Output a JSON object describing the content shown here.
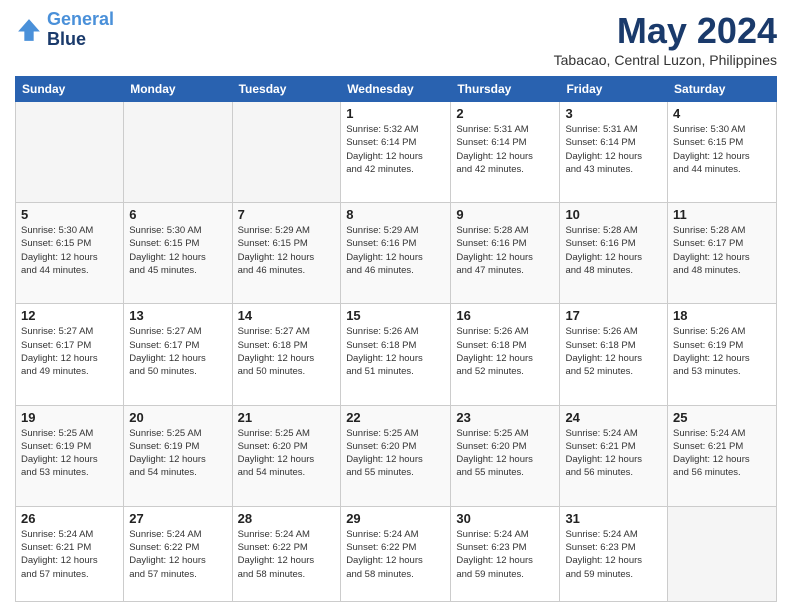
{
  "logo": {
    "line1": "General",
    "line2": "Blue"
  },
  "title": "May 2024",
  "location": "Tabacao, Central Luzon, Philippines",
  "weekdays": [
    "Sunday",
    "Monday",
    "Tuesday",
    "Wednesday",
    "Thursday",
    "Friday",
    "Saturday"
  ],
  "weeks": [
    [
      {
        "day": "",
        "info": ""
      },
      {
        "day": "",
        "info": ""
      },
      {
        "day": "",
        "info": ""
      },
      {
        "day": "1",
        "info": "Sunrise: 5:32 AM\nSunset: 6:14 PM\nDaylight: 12 hours\nand 42 minutes."
      },
      {
        "day": "2",
        "info": "Sunrise: 5:31 AM\nSunset: 6:14 PM\nDaylight: 12 hours\nand 42 minutes."
      },
      {
        "day": "3",
        "info": "Sunrise: 5:31 AM\nSunset: 6:14 PM\nDaylight: 12 hours\nand 43 minutes."
      },
      {
        "day": "4",
        "info": "Sunrise: 5:30 AM\nSunset: 6:15 PM\nDaylight: 12 hours\nand 44 minutes."
      }
    ],
    [
      {
        "day": "5",
        "info": "Sunrise: 5:30 AM\nSunset: 6:15 PM\nDaylight: 12 hours\nand 44 minutes."
      },
      {
        "day": "6",
        "info": "Sunrise: 5:30 AM\nSunset: 6:15 PM\nDaylight: 12 hours\nand 45 minutes."
      },
      {
        "day": "7",
        "info": "Sunrise: 5:29 AM\nSunset: 6:15 PM\nDaylight: 12 hours\nand 46 minutes."
      },
      {
        "day": "8",
        "info": "Sunrise: 5:29 AM\nSunset: 6:16 PM\nDaylight: 12 hours\nand 46 minutes."
      },
      {
        "day": "9",
        "info": "Sunrise: 5:28 AM\nSunset: 6:16 PM\nDaylight: 12 hours\nand 47 minutes."
      },
      {
        "day": "10",
        "info": "Sunrise: 5:28 AM\nSunset: 6:16 PM\nDaylight: 12 hours\nand 48 minutes."
      },
      {
        "day": "11",
        "info": "Sunrise: 5:28 AM\nSunset: 6:17 PM\nDaylight: 12 hours\nand 48 minutes."
      }
    ],
    [
      {
        "day": "12",
        "info": "Sunrise: 5:27 AM\nSunset: 6:17 PM\nDaylight: 12 hours\nand 49 minutes."
      },
      {
        "day": "13",
        "info": "Sunrise: 5:27 AM\nSunset: 6:17 PM\nDaylight: 12 hours\nand 50 minutes."
      },
      {
        "day": "14",
        "info": "Sunrise: 5:27 AM\nSunset: 6:18 PM\nDaylight: 12 hours\nand 50 minutes."
      },
      {
        "day": "15",
        "info": "Sunrise: 5:26 AM\nSunset: 6:18 PM\nDaylight: 12 hours\nand 51 minutes."
      },
      {
        "day": "16",
        "info": "Sunrise: 5:26 AM\nSunset: 6:18 PM\nDaylight: 12 hours\nand 52 minutes."
      },
      {
        "day": "17",
        "info": "Sunrise: 5:26 AM\nSunset: 6:18 PM\nDaylight: 12 hours\nand 52 minutes."
      },
      {
        "day": "18",
        "info": "Sunrise: 5:26 AM\nSunset: 6:19 PM\nDaylight: 12 hours\nand 53 minutes."
      }
    ],
    [
      {
        "day": "19",
        "info": "Sunrise: 5:25 AM\nSunset: 6:19 PM\nDaylight: 12 hours\nand 53 minutes."
      },
      {
        "day": "20",
        "info": "Sunrise: 5:25 AM\nSunset: 6:19 PM\nDaylight: 12 hours\nand 54 minutes."
      },
      {
        "day": "21",
        "info": "Sunrise: 5:25 AM\nSunset: 6:20 PM\nDaylight: 12 hours\nand 54 minutes."
      },
      {
        "day": "22",
        "info": "Sunrise: 5:25 AM\nSunset: 6:20 PM\nDaylight: 12 hours\nand 55 minutes."
      },
      {
        "day": "23",
        "info": "Sunrise: 5:25 AM\nSunset: 6:20 PM\nDaylight: 12 hours\nand 55 minutes."
      },
      {
        "day": "24",
        "info": "Sunrise: 5:24 AM\nSunset: 6:21 PM\nDaylight: 12 hours\nand 56 minutes."
      },
      {
        "day": "25",
        "info": "Sunrise: 5:24 AM\nSunset: 6:21 PM\nDaylight: 12 hours\nand 56 minutes."
      }
    ],
    [
      {
        "day": "26",
        "info": "Sunrise: 5:24 AM\nSunset: 6:21 PM\nDaylight: 12 hours\nand 57 minutes."
      },
      {
        "day": "27",
        "info": "Sunrise: 5:24 AM\nSunset: 6:22 PM\nDaylight: 12 hours\nand 57 minutes."
      },
      {
        "day": "28",
        "info": "Sunrise: 5:24 AM\nSunset: 6:22 PM\nDaylight: 12 hours\nand 58 minutes."
      },
      {
        "day": "29",
        "info": "Sunrise: 5:24 AM\nSunset: 6:22 PM\nDaylight: 12 hours\nand 58 minutes."
      },
      {
        "day": "30",
        "info": "Sunrise: 5:24 AM\nSunset: 6:23 PM\nDaylight: 12 hours\nand 59 minutes."
      },
      {
        "day": "31",
        "info": "Sunrise: 5:24 AM\nSunset: 6:23 PM\nDaylight: 12 hours\nand 59 minutes."
      },
      {
        "day": "",
        "info": ""
      }
    ]
  ]
}
